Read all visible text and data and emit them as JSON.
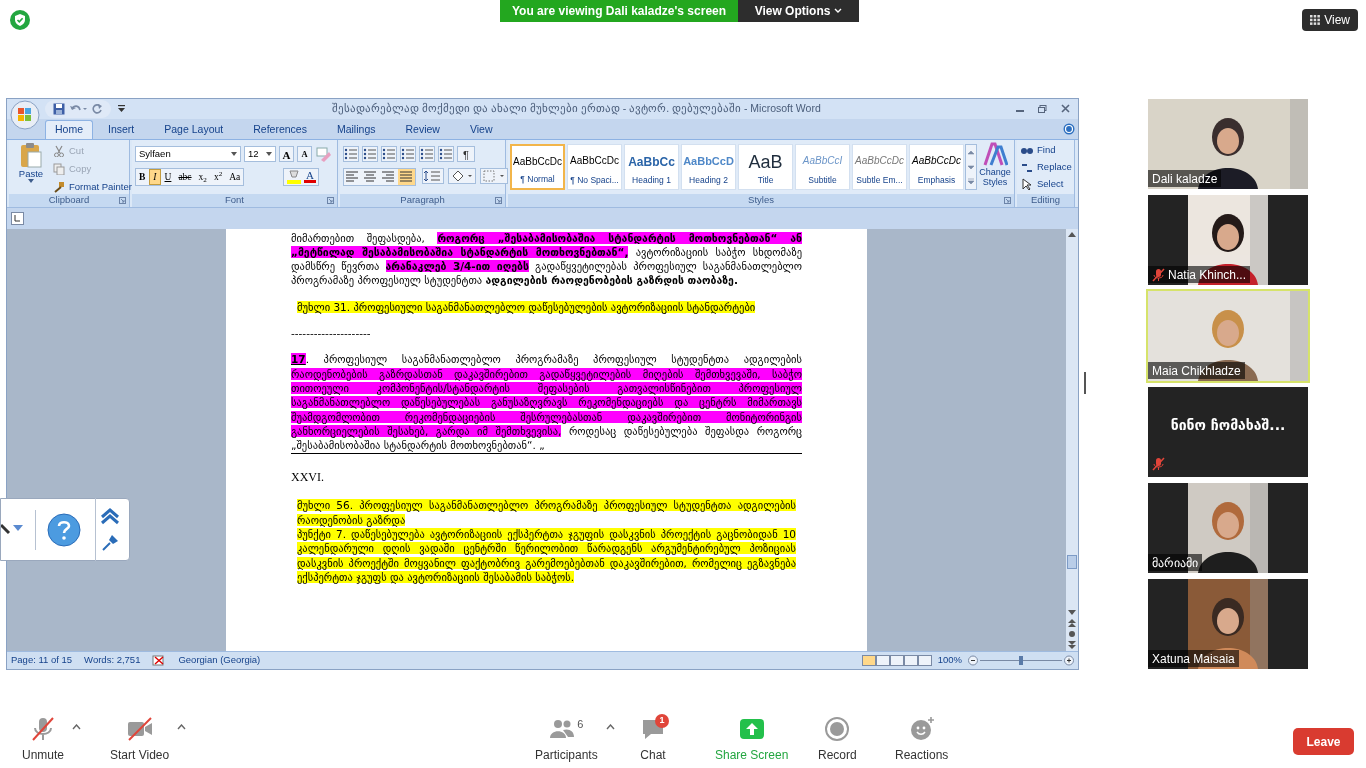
{
  "banner": {
    "text": "You are viewing Dali kaladze's screen",
    "options": "View Options"
  },
  "view_button": "View",
  "word": {
    "title": "შესადარებლად მოქმედი და ახალი მუხლები ერთად - ავტორ. დებულებაში - Microsoft Word",
    "tabs": [
      {
        "label": "Home",
        "selected": true
      },
      {
        "label": "Insert",
        "selected": false
      },
      {
        "label": "Page Layout",
        "selected": false
      },
      {
        "label": "References",
        "selected": false
      },
      {
        "label": "Mailings",
        "selected": false
      },
      {
        "label": "Review",
        "selected": false
      },
      {
        "label": "View",
        "selected": false
      }
    ],
    "clipboard": {
      "paste": "Paste",
      "group": "Clipboard",
      "items": [
        {
          "label": "Cut",
          "disabled": true
        },
        {
          "label": "Copy",
          "disabled": true
        },
        {
          "label": "Format Painter",
          "disabled": false
        }
      ]
    },
    "font": {
      "group": "Font",
      "name": "Sylfaen",
      "size": "12",
      "size_buttons": [
        "A",
        "A"
      ],
      "format": [
        {
          "label": "B",
          "on": false
        },
        {
          "label": "I",
          "on": true
        },
        {
          "label": "U",
          "on": false
        },
        {
          "label": "abc",
          "on": false
        },
        {
          "label": "x$_{2}$",
          "on": false
        },
        {
          "label": "x$^{2}$",
          "on": false
        },
        {
          "label": "Aa",
          "on": false
        }
      ],
      "color_label": "A"
    },
    "paragraph": {
      "group": "Paragraph",
      "mark": "¶",
      "align": [
        {
          "on": false
        },
        {
          "on": false
        },
        {
          "on": false
        },
        {
          "on": true
        }
      ]
    },
    "styles": {
      "group": "Styles",
      "change": "Change Styles",
      "items": [
        {
          "sample": "AaBbCcDc",
          "label": "¶ Normal",
          "kind": "normal",
          "selected": true
        },
        {
          "sample": "AaBbCcDc",
          "label": "¶ No Spaci...",
          "kind": "normal",
          "selected": false
        },
        {
          "sample": "AaBbCc",
          "label": "Heading 1",
          "kind": "heading1",
          "selected": false
        },
        {
          "sample": "AaBbCcD",
          "label": "Heading 2",
          "kind": "heading2",
          "selected": false
        },
        {
          "sample": "AaB",
          "label": "Title",
          "kind": "title",
          "selected": false
        },
        {
          "sample": "AaBbCcI",
          "label": "Subtitle",
          "kind": "subtitle",
          "selected": false
        },
        {
          "sample": "AaBbCcDc",
          "label": "Subtle Em...",
          "kind": "subtle",
          "selected": false
        },
        {
          "sample": "AaBbCcDc",
          "label": "Emphasis",
          "kind": "emphasis",
          "selected": false
        }
      ]
    },
    "editing": {
      "group": "Editing",
      "items": [
        {
          "label": "Find",
          "kind": "find"
        },
        {
          "label": "Replace",
          "kind": "replace"
        },
        {
          "label": "Select",
          "kind": "select"
        }
      ]
    },
    "document": [
      {
        "kind": "para",
        "runs": [
          {
            "text": "მიმართებით შეფასდება, "
          },
          {
            "text": "როგორც „შესაბამისობაშია სტანდარტის მოთხოვნებთან“ ან „მეტწილად შესაბამისობაშია სტანდარტის მოთხოვნებთან“,",
            "bold": true,
            "color": "#ff00ff"
          },
          {
            "text": " ავტორიზაციის საბჭო სხდომაზე დამსწრე წევრთა "
          },
          {
            "text": "არანაკლებ 3/4-ით იღებს",
            "bold": true,
            "color": "#ff00ff"
          },
          {
            "text": " გადაწყვეტილებას პროფესიულ საგანმანათლებლო პროგრამაზე პროფესიულ სტუდენტთა "
          },
          {
            "text": "ადგილების რაოდენობების გაზრდის თაობაზე.",
            "bold": true
          }
        ]
      },
      {
        "kind": "article",
        "paras": [
          [
            {
              "text": "მუხლი 31. პროფესიული საგანმანათლებლო დაწესებულების ავტორიზაციის სტანდარტები",
              "color": "#ffff00"
            }
          ]
        ]
      },
      {
        "kind": "plain",
        "text": "---------------------"
      },
      {
        "kind": "para",
        "rule_below": true,
        "runs": [
          {
            "text": "17",
            "bold": true,
            "underline": true,
            "color": "#ff00ff"
          },
          {
            "text": ". პროფესიულ საგანმანათლებლო პროგრამაზე პროფესიულ სტუდენტთა ადგილების "
          },
          {
            "text": "რაოდენობების გაზრდასთან დაკავშირებით გადაწყვეტილების მიღების შემთხვევაში, საბჭო თითოეული კომპონენტის/სტანდარტის შეფასების გათვალისწინებით პროფესიულ საგანმანათლებლო დაწესებულებას განუსაზღვრავს რეკომენდაციებს და ცენტრს მიმართავს შუამდგომლობით რეკომენდაციების შესრულებასთან დაკავშირებით მონიტორინგის განხორციელების შესახებ, გარდა იმ შემთხვევისა,",
            "color": "#ff00ff"
          },
          {
            "text": " როდესაც დაწესებულება შეფასდა როგორც „შესაბამისობაშია სტანდარტის მოთხოვნებთან“. „"
          }
        ]
      },
      {
        "kind": "section",
        "text": "XXVI."
      },
      {
        "kind": "article",
        "paras": [
          [
            {
              "text": "მუხლი 56. პროფესიულ საგანმანათლებლო პროგრამაზე პროფესიულ სტუდენტთა ადგილების რაოდენობის გაზრდა",
              "color": "#ffff00"
            }
          ],
          [
            {
              "text": "პუნქტი 7. დაწესებულება ავტორიზაციის ექსპერტთა ჯგუფის დასკვნის პროექტის გაცნობიდან 10 კალენდარული დღის ვადაში ცენტრში წერილობით წარადგენს არგუმენტირებულ პოზიციას დასკვნის პროექტში მოყვანილ ფაქტობრივ გარემოებებთან დაკავშირებით, რომელიც ეგზავნება ექსპერტთა ჯგუფს და ავტორიზაციის შესაბამის საბჭოს.",
              "color": "#ffff00"
            }
          ]
        ]
      }
    ],
    "status": {
      "page": "Page: 11 of 15",
      "words": "Words: 2,751",
      "language": "Georgian (Georgia)",
      "zoom": "100%",
      "zoom_slider": {
        "level": 0.5
      }
    }
  },
  "participants": [
    {
      "name": "Dali kaladze",
      "video": true,
      "kind": "wide",
      "muted": false,
      "speaking": false
    },
    {
      "name": "Natia Khinch...",
      "video": true,
      "kind": "narrow",
      "muted": true,
      "speaking": false
    },
    {
      "name": "Maia Chikhladze",
      "video": true,
      "kind": "wide",
      "muted": false,
      "speaking": true
    },
    {
      "name": "ნინო ჩომახაშ...",
      "video": false,
      "muted": true,
      "speaking": false
    },
    {
      "name": "მარიამი",
      "video": true,
      "kind": "narrow",
      "muted": false,
      "speaking": false
    },
    {
      "name": "Xatuna Maisaia",
      "video": true,
      "kind": "narrow",
      "muted": false,
      "speaking": false
    }
  ],
  "toolbar": [
    {
      "kind": "mic",
      "label": "Unmute",
      "off": true,
      "caret": true
    },
    {
      "kind": "video",
      "label": "Start Video",
      "off": true,
      "caret": true
    },
    {
      "kind": "participants",
      "label": "Participants",
      "count": "6",
      "caret": true
    },
    {
      "kind": "chat",
      "label": "Chat",
      "badge": "1"
    },
    {
      "kind": "share",
      "label": "Share Screen"
    },
    {
      "kind": "record",
      "label": "Record"
    },
    {
      "kind": "reactions",
      "label": "Reactions"
    }
  ],
  "leave": "Leave"
}
